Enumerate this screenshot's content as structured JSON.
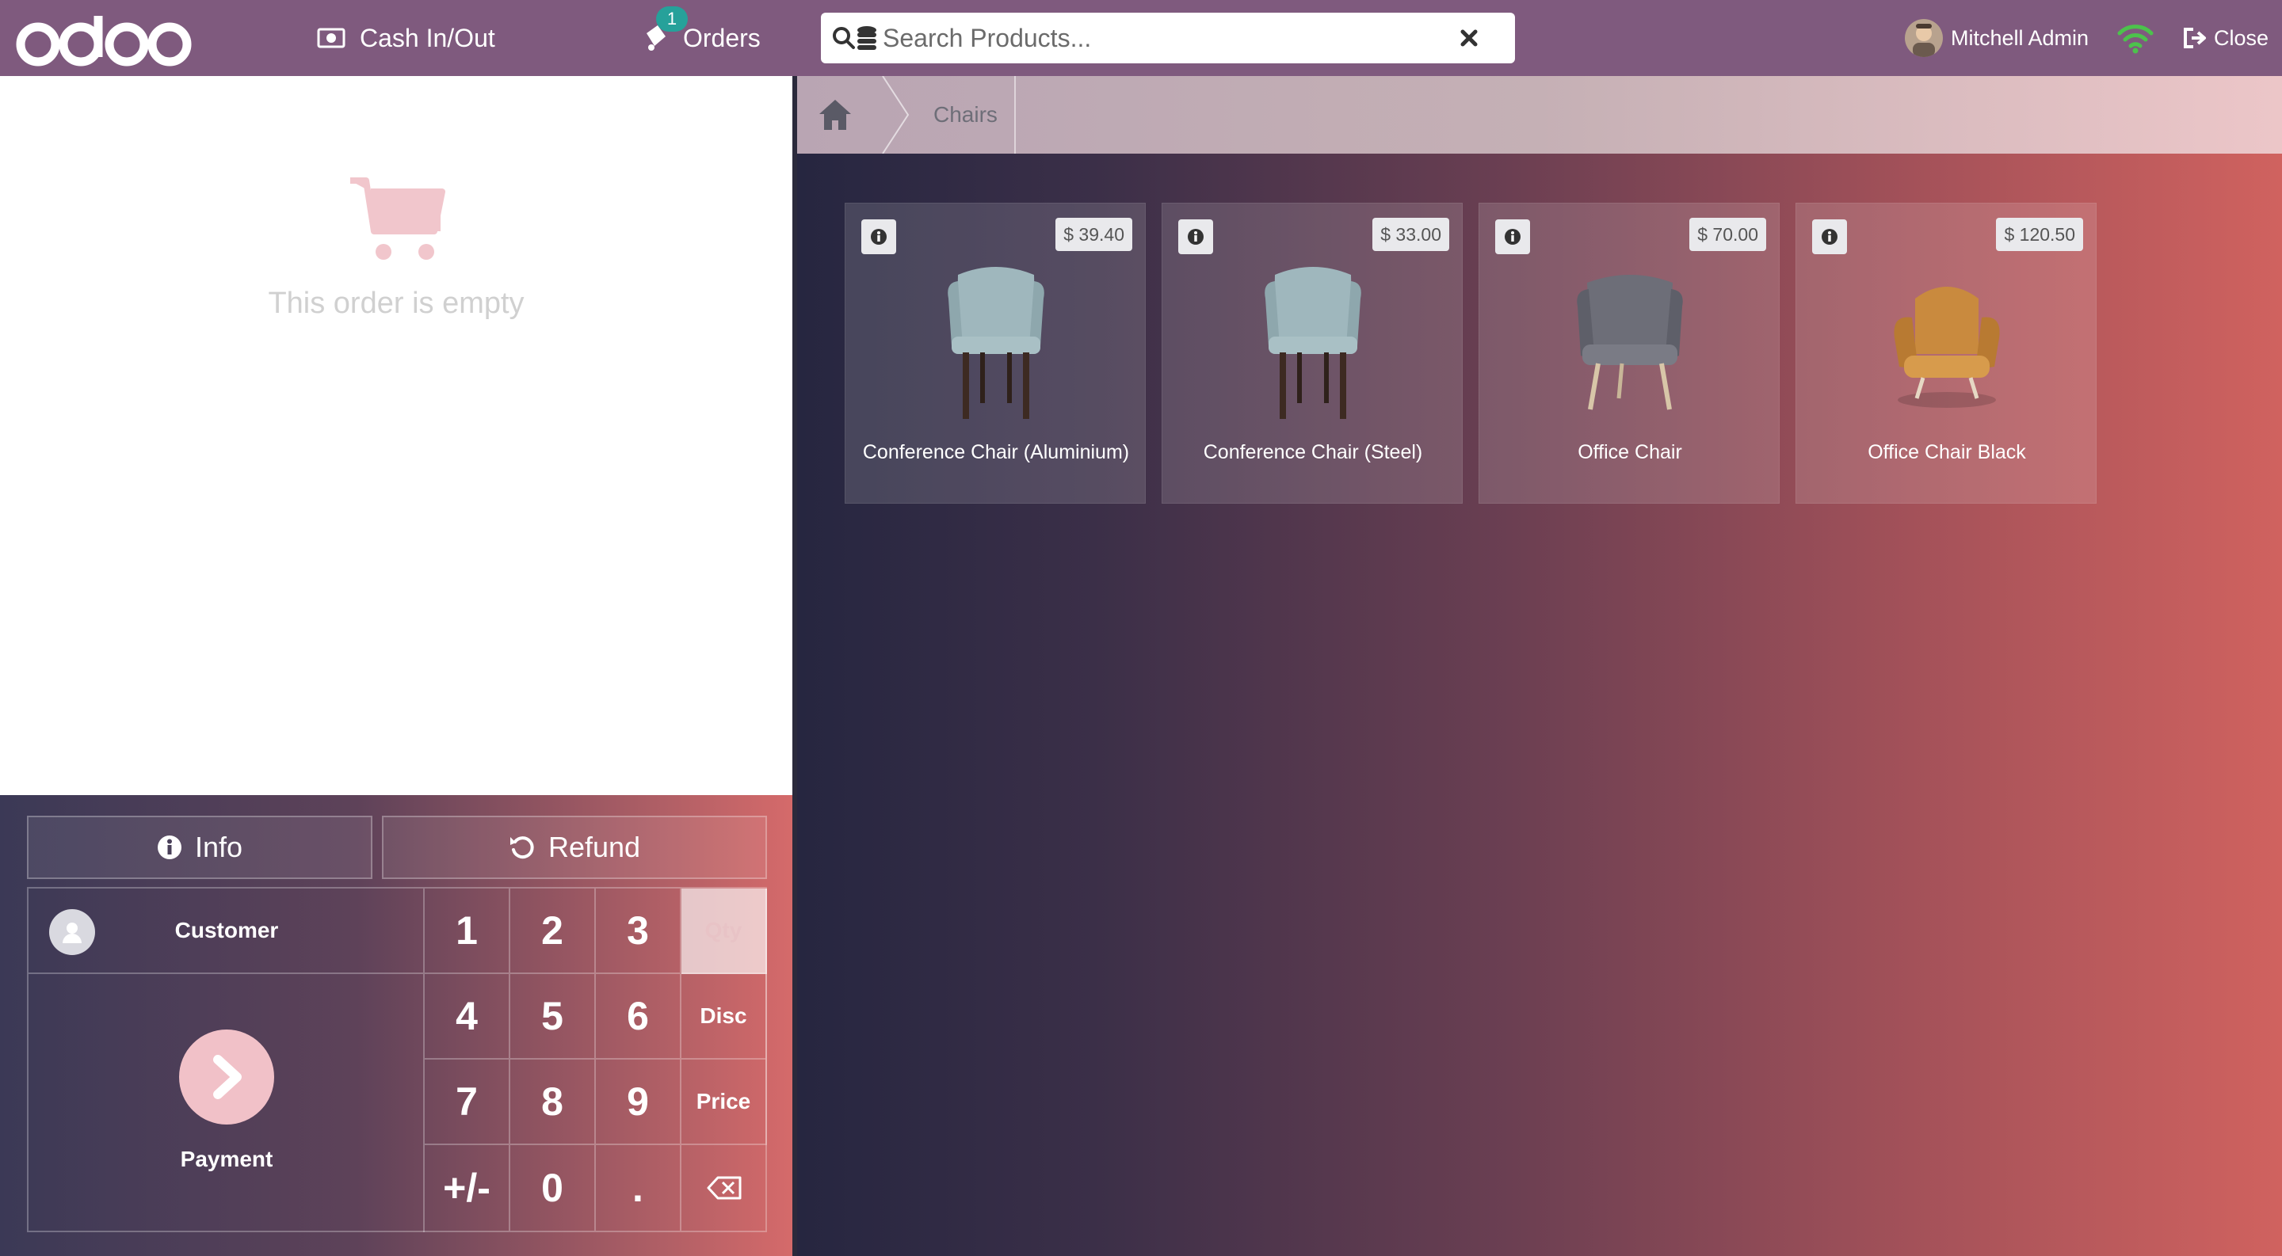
{
  "navbar": {
    "logo_text": "odoo",
    "cash_label": "Cash In/Out",
    "orders_label": "Orders",
    "orders_count": "1",
    "search_placeholder": "Search Products...",
    "user_name": "Mitchell Admin",
    "close_label": "Close"
  },
  "order": {
    "empty_text": "This order is empty"
  },
  "controls": {
    "info_label": "Info",
    "refund_label": "Refund",
    "customer_label": "Customer",
    "payment_label": "Payment"
  },
  "numpad": {
    "keys": [
      "1",
      "2",
      "3",
      "4",
      "5",
      "6",
      "7",
      "8",
      "9",
      "+/-",
      "0",
      "."
    ],
    "modes": [
      "Qty",
      "Disc",
      "Price"
    ],
    "active_mode": "Qty"
  },
  "breadcrumb": {
    "category": "Chairs"
  },
  "products": [
    {
      "name": "Conference Chair (Aluminium)",
      "price": "$ 39.40"
    },
    {
      "name": "Conference Chair (Steel)",
      "price": "$ 33.00"
    },
    {
      "name": "Office Chair",
      "price": "$ 70.00"
    },
    {
      "name": "Office Chair Black",
      "price": "$ 120.50"
    }
  ],
  "colors": {
    "navbar": "#7f5a7e",
    "badge": "#26a19a",
    "payment_circle": "#f1c1c8"
  }
}
